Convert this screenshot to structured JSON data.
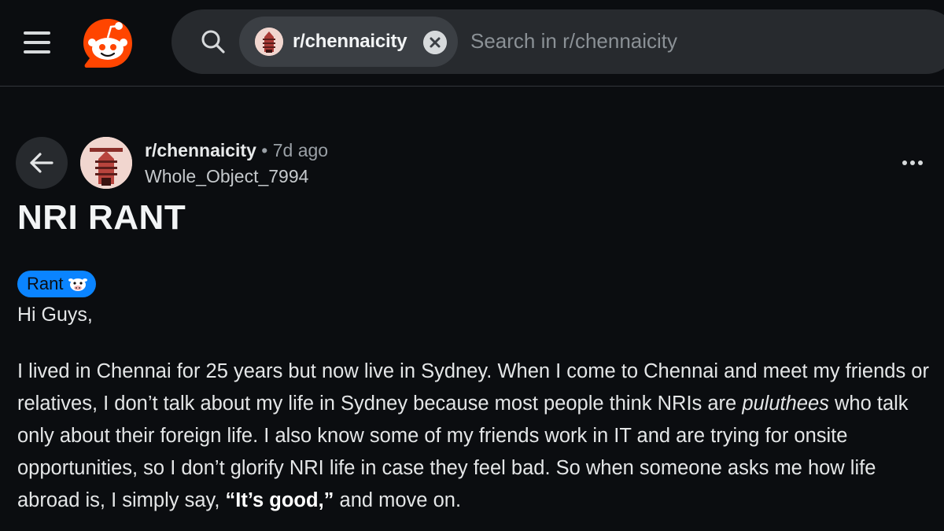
{
  "header": {
    "menu_icon": "hamburger-icon",
    "logo_icon": "reddit-logo-icon",
    "search": {
      "icon": "search-icon",
      "chip_label": "r/chennaicity",
      "chip_close_icon": "close-circle-icon",
      "placeholder": "Search in r/chennaicity"
    }
  },
  "post": {
    "back_icon": "arrow-left-icon",
    "subreddit": "r/chennaicity",
    "separator": "•",
    "time": "7d ago",
    "author": "Whole_Object_7994",
    "more_icon": "more-horizontal-icon",
    "title": "NRI RANT",
    "flair": {
      "label": "Rant",
      "emoji_icon": "cow-emoji-icon",
      "color": "#0a84ff"
    },
    "greeting": "Hi Guys,",
    "body": {
      "part1": "I lived in Chennai for 25 years but now live in Sydney. When I come to Chennai and meet my friends or relatives, I don’t talk about my life in Sydney because most people think NRIs are ",
      "italic": "puluthees",
      "part2": " who talk only about their foreign life. I also know some of my friends work in IT and are trying for onsite opportunities, so I don’t glorify NRI life in case they feel bad. So when someone asks me how life abroad is, I simply say, ",
      "bold": "“It’s good,”",
      "part3": " and move on."
    }
  },
  "colors": {
    "background": "#0b0d10",
    "brand": "#ff4500",
    "flair": "#0a84ff"
  }
}
